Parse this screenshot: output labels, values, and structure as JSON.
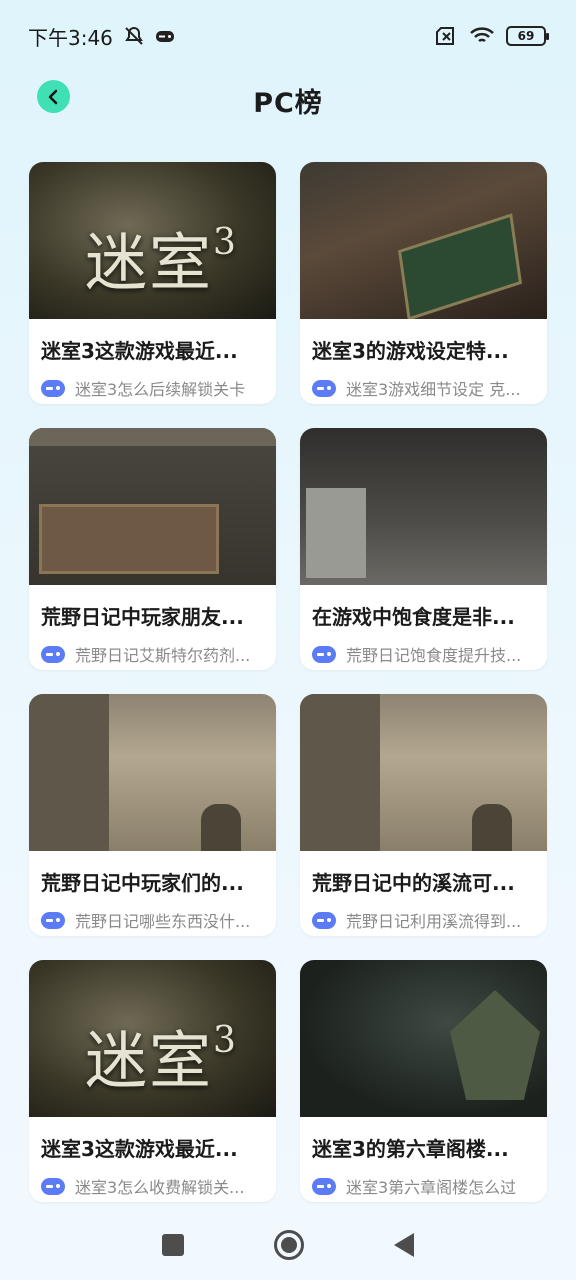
{
  "status_bar": {
    "time": "下午3:46",
    "battery": "69"
  },
  "header": {
    "title": "PC榜"
  },
  "cards": [
    {
      "title": "迷室3这款游戏最近...",
      "subtitle": "迷室3怎么后续解锁关卡",
      "art": "mishi"
    },
    {
      "title": "迷室3的游戏设定特...",
      "subtitle": "迷室3游戏细节设定 克...",
      "art": "book"
    },
    {
      "title": "荒野日记中玩家朋友...",
      "subtitle": "荒野日记艾斯特尔药剂...",
      "art": "panel"
    },
    {
      "title": "在游戏中饱食度是非...",
      "subtitle": "荒野日记饱食度提升技...",
      "art": "survival"
    },
    {
      "title": "荒野日记中玩家们的...",
      "subtitle": "荒野日记哪些东西没什...",
      "art": "ruins"
    },
    {
      "title": "荒野日记中的溪流可...",
      "subtitle": "荒野日记利用溪流得到...",
      "art": "ruins"
    },
    {
      "title": "迷室3这款游戏最近...",
      "subtitle": "迷室3怎么收费解锁关...",
      "art": "mishi"
    },
    {
      "title": "迷室3的第六章阁楼...",
      "subtitle": "迷室3第六章阁楼怎么过",
      "art": "dice"
    }
  ],
  "art_text": {
    "mishi_logo": "迷室",
    "mishi_logo_num": "3"
  },
  "icons": {
    "back": "chevron-left-icon",
    "category": "gamepad-icon"
  },
  "colors": {
    "accent": "#3fe0b4",
    "gamepad": "#5b7cf6"
  }
}
